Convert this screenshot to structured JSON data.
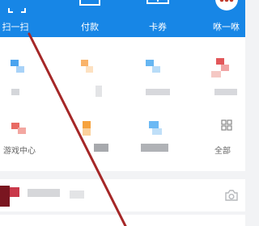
{
  "topbar": {
    "items": [
      {
        "label": "扫一扫",
        "icon": "scan-icon"
      },
      {
        "label": "付款",
        "icon": "payment-icon"
      },
      {
        "label": "卡券",
        "icon": "card-coupon-icon"
      },
      {
        "label": "咻一咻",
        "icon": "xiu-icon"
      }
    ]
  },
  "grid": {
    "row2_labels": [
      "游戏中心",
      "全部"
    ]
  },
  "colors": {
    "brand_blue": "#1786e6",
    "annotation_red": "#a52727"
  },
  "icons": {
    "camera": "camera-icon"
  }
}
